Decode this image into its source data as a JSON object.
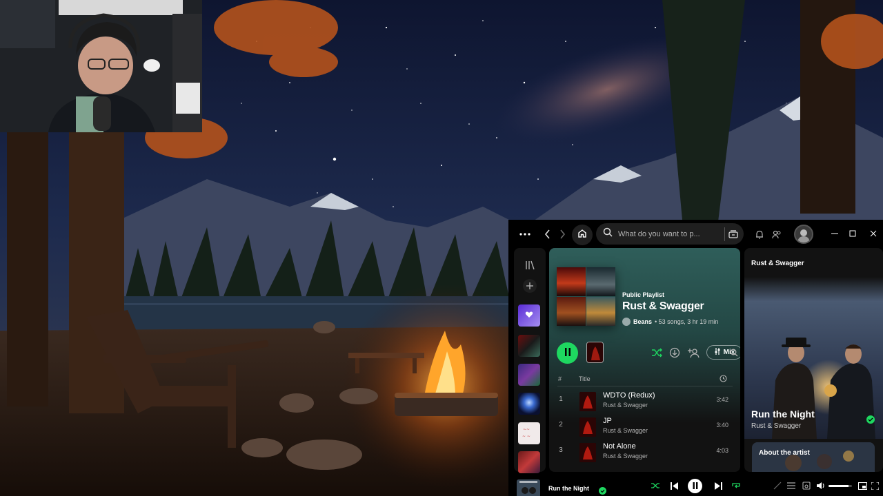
{
  "window": {
    "search_placeholder": "What do you want to p...",
    "menu_icon": "more-dots-icon",
    "back_icon": "chevron-left-icon",
    "forward_icon": "chevron-right-icon",
    "home_icon": "home-icon",
    "search_icon": "search-icon",
    "browse_icon": "browse-icon",
    "notification_icon": "bell-icon",
    "friends_icon": "friends-icon",
    "minimize_icon": "minimize-icon",
    "maximize_icon": "maximize-icon",
    "close_icon": "close-icon"
  },
  "playlist": {
    "type_label": "Public Playlist",
    "title": "Rust & Swagger",
    "owner": "Beans",
    "meta": "• 53 songs, 3 hr 19 min",
    "mix_label": "Mix",
    "column_number": "#",
    "column_title": "Title"
  },
  "tracks": [
    {
      "number": "1",
      "title": "WDTO (Redux)",
      "artist": "Rust & Swagger",
      "duration": "3:42"
    },
    {
      "number": "2",
      "title": "JP",
      "artist": "Rust & Swagger",
      "duration": "3:40"
    },
    {
      "number": "3",
      "title": "Not Alone",
      "artist": "Rust & Swagger",
      "duration": "4:03"
    }
  ],
  "now_playing_panel": {
    "header": "Rust & Swagger",
    "title": "Run the Night",
    "artist": "Rust & Swagger",
    "about_label": "About the artist"
  },
  "player": {
    "title": "Run the Night",
    "volume_fraction": 0.85
  },
  "colors": {
    "accent": "#1ed760",
    "playlist_gradient_top": "#2f5e5a"
  }
}
